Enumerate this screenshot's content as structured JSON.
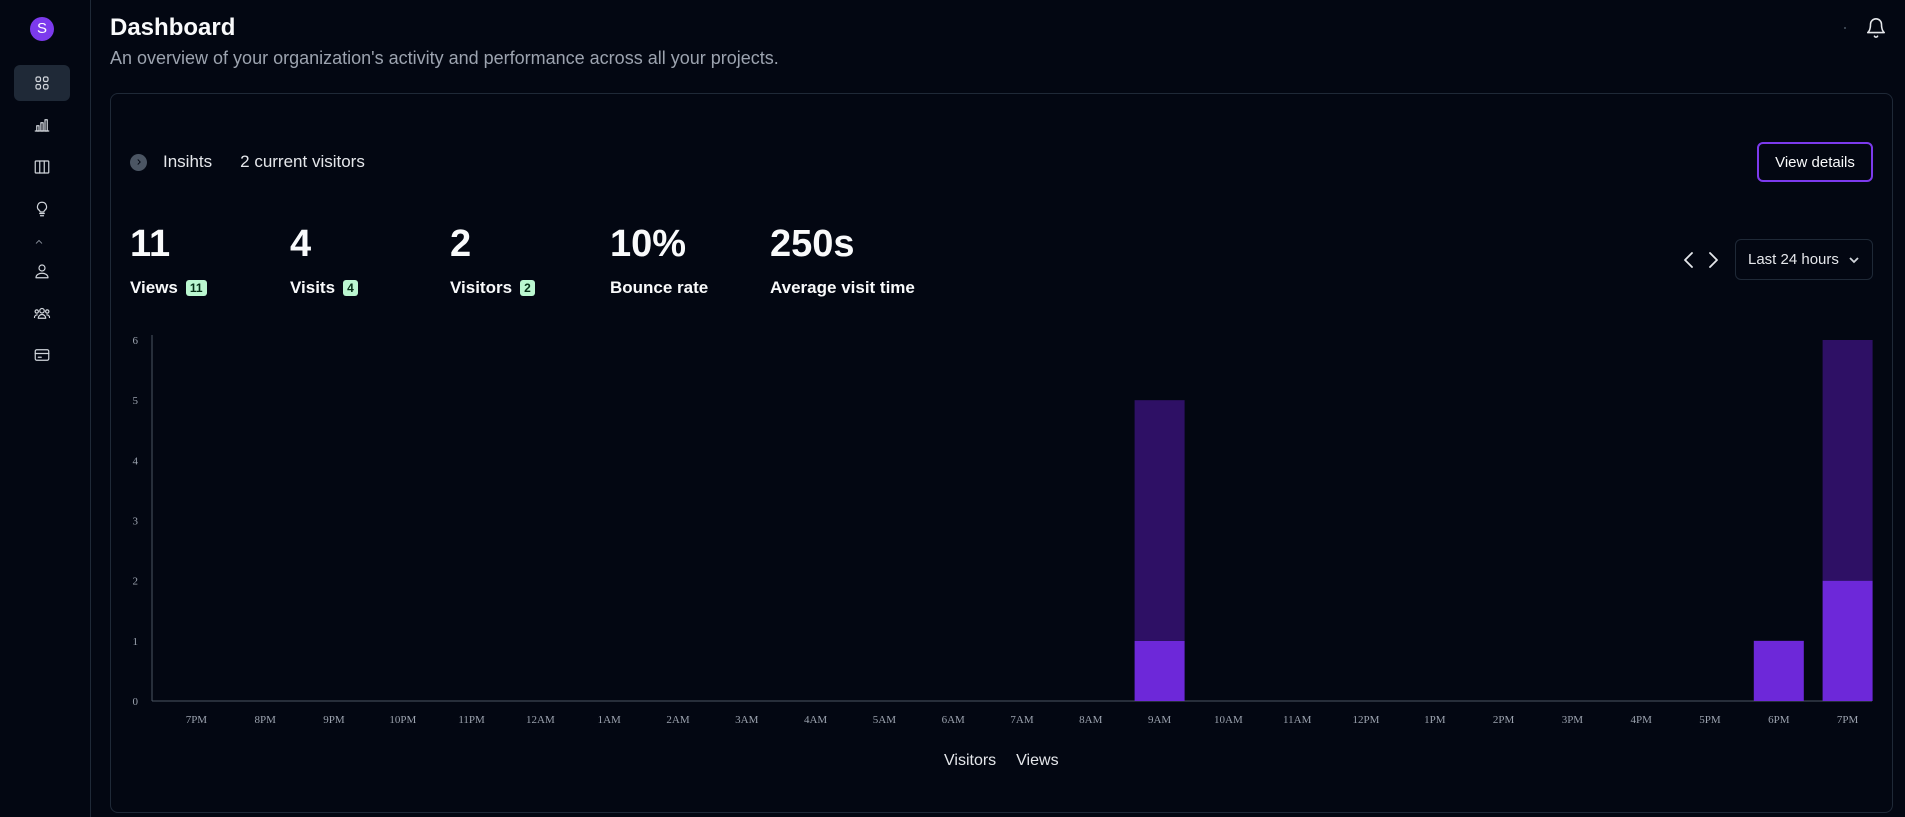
{
  "sidebar": {
    "avatar_letter": "S",
    "items": [
      {
        "name": "dashboard",
        "icon": "grid-icon",
        "active": true
      },
      {
        "name": "analytics",
        "icon": "bar-chart-icon",
        "active": false
      },
      {
        "name": "board",
        "icon": "columns-icon",
        "active": false
      },
      {
        "name": "ideas",
        "icon": "lightbulb-icon",
        "active": false
      },
      {
        "name": "profile",
        "icon": "user-icon",
        "active": false
      },
      {
        "name": "team",
        "icon": "users-icon",
        "active": false
      },
      {
        "name": "billing",
        "icon": "credit-card-icon",
        "active": false
      }
    ]
  },
  "header": {
    "title": "Dashboard",
    "subtitle": "An overview of your organization's activity and performance across all your projects."
  },
  "insights": {
    "label": "Insihts",
    "current_visitors": "2 current visitors",
    "view_details_label": "View details"
  },
  "stats": [
    {
      "value": "11",
      "label": "Views",
      "badge": "11"
    },
    {
      "value": "4",
      "label": "Visits",
      "badge": "4"
    },
    {
      "value": "2",
      "label": "Visitors",
      "badge": "2"
    },
    {
      "value": "10%",
      "label": "Bounce rate",
      "badge": ""
    },
    {
      "value": "250s",
      "label": "Average visit time",
      "badge": ""
    }
  ],
  "range": {
    "selected": "Last 24 hours"
  },
  "colors": {
    "visitors": "#6d28d9",
    "views": "#2e1065",
    "accent": "#7c3aed",
    "badge_bg": "#bbf7d0"
  },
  "chart_data": {
    "type": "bar",
    "stacked": true,
    "categories": [
      "7PM",
      "8PM",
      "9PM",
      "10PM",
      "11PM",
      "12AM",
      "1AM",
      "2AM",
      "3AM",
      "4AM",
      "5AM",
      "6AM",
      "7AM",
      "8AM",
      "9AM",
      "10AM",
      "11AM",
      "12PM",
      "1PM",
      "2PM",
      "3PM",
      "4PM",
      "5PM",
      "6PM",
      "7PM"
    ],
    "series": [
      {
        "name": "Visitors",
        "values": [
          0,
          0,
          0,
          0,
          0,
          0,
          0,
          0,
          0,
          0,
          0,
          0,
          0,
          0,
          1,
          0,
          0,
          0,
          0,
          0,
          0,
          0,
          0,
          1,
          2
        ]
      },
      {
        "name": "Views",
        "values": [
          0,
          0,
          0,
          0,
          0,
          0,
          0,
          0,
          0,
          0,
          0,
          0,
          0,
          0,
          4,
          0,
          0,
          0,
          0,
          0,
          0,
          0,
          0,
          0,
          4
        ]
      }
    ],
    "yticks": [
      0,
      1,
      2,
      3,
      4,
      5,
      6
    ],
    "ylim": [
      0,
      6
    ],
    "grid": false,
    "legend": "bottom-center"
  }
}
